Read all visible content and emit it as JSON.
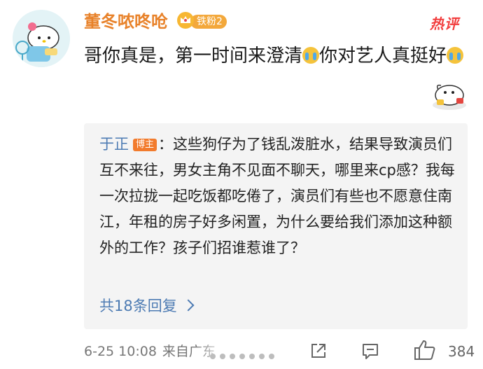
{
  "comment": {
    "username": "董冬哝咚呛",
    "fan_badge": "铁粉2",
    "hot_tag": "热评",
    "text_part1": "哥你真是，第一时间来澄清",
    "text_part2": "你对艺人真挺好",
    "emoji_icon": "crying-face-icon"
  },
  "reply": {
    "author": "于正",
    "owner_badge": "博主",
    "text": "：这些狗仔为了钱乱泼脏水，结果导致演员们互不来往，男女主角不见面不聊天，哪里来cp感？我每一次拉拢一起吃饭都吃倦了，演员们有些也不愿意住南江，年租的房子好多闲置，为什么要给我们添加这种额外的工作？孩子们招谁惹谁了？",
    "more_replies": "共18条回复"
  },
  "meta": {
    "datetime": "6-25 10:08",
    "source": "来自广东",
    "like_count": "384"
  },
  "colors": {
    "username": "#e8822a",
    "link": "#4d7bb3",
    "hot": "#f23d3d",
    "reply_bg": "#f4f4f4"
  }
}
